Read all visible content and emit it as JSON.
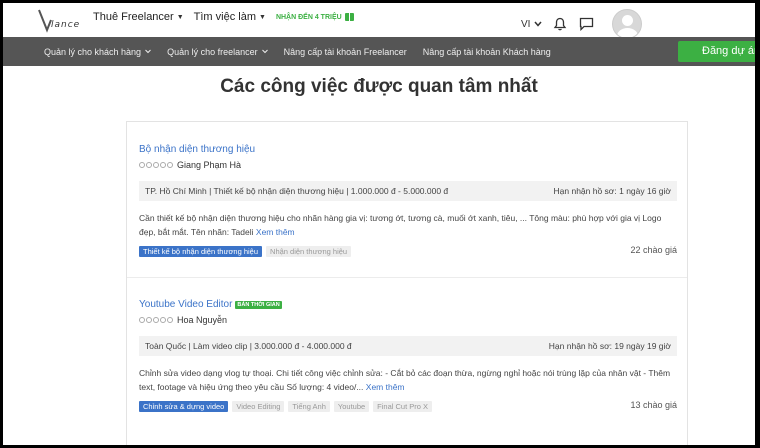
{
  "header": {
    "logo_text": "lance",
    "nav": [
      {
        "label": "Thuê Freelancer",
        "has_caret": true
      },
      {
        "label": "Tìm việc làm",
        "has_caret": true
      }
    ],
    "promo": "NHẬN ĐẾN 4 TRIỆU",
    "lang": "VI"
  },
  "subnav": {
    "items": [
      {
        "label": "Quản lý cho khách hàng"
      },
      {
        "label": "Quản lý cho freelancer"
      },
      {
        "label": "Nâng cấp tài khoản Freelancer"
      },
      {
        "label": "Nâng cấp tài khoản Khách hàng"
      }
    ],
    "post_button": "Đăng dự án"
  },
  "page_title": "Các công việc được quan tâm nhất",
  "jobs": [
    {
      "title": "Bộ nhận diện thương hiệu",
      "badge": "",
      "client": "Giang Phạm Hà",
      "meta_left": "TP. Hồ Chí Minh | Thiết kế bộ nhận diện thương hiệu | 1.000.000 đ - 5.000.000 đ",
      "meta_right": "Hạn nhận hồ sơ: 1 ngày 16 giờ",
      "desc": "Cần thiết kế bộ nhận diện thương hiệu cho nhãn hàng gia vị: tương ớt, tương cà, muối ớt xanh, tiêu, ... Tông màu: phù hợp với gia vị Logo đẹp, bắt mắt. Tên nhãn: Tadeli",
      "more": "Xem thêm",
      "tags": [
        "Thiết kế bộ nhận diện thương hiệu",
        "Nhận diện thương hiệu"
      ],
      "bids": "22 chào giá"
    },
    {
      "title": "Youtube Video Editor",
      "badge": "BÁN THỜI GIAN",
      "client": "Hoa Nguyễn",
      "meta_left": "Toàn Quốc | Làm video clip | 3.000.000 đ - 4.000.000 đ",
      "meta_right": "Hạn nhận hồ sơ: 19 ngày 19 giờ",
      "desc": "Chỉnh sửa video dạng vlog tự thoại. Chi tiết công việc chỉnh sửa: - Cắt bỏ các đoạn thừa, ngừng nghỉ hoặc nói trùng lặp của nhân vật - Thêm text, footage và hiệu ứng theo yêu cầu Số lượng: 4 video/...",
      "more": "Xem thêm",
      "tags": [
        "Chỉnh sửa & dựng video",
        "Video Editing",
        "Tiếng Anh",
        "Youtube",
        "Final Cut Pro X"
      ],
      "bids": "13 chào giá"
    }
  ]
}
